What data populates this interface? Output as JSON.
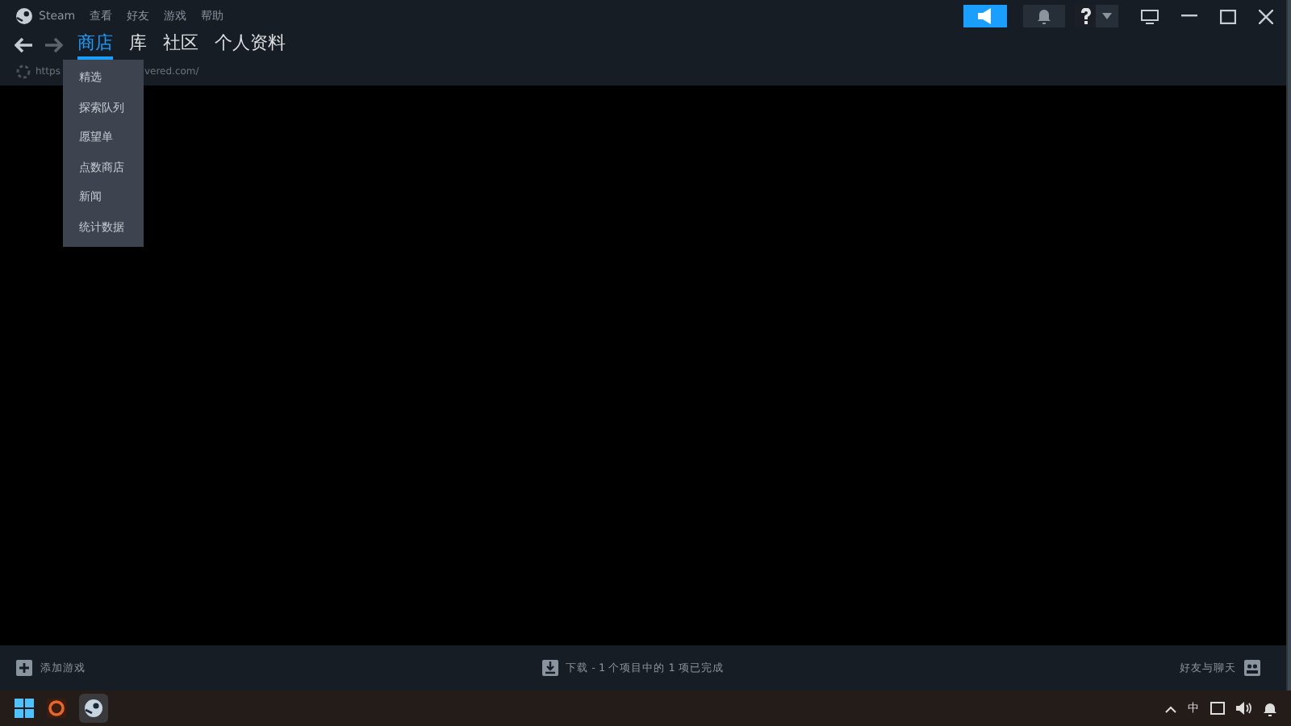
{
  "window": {
    "app_name": "Steam",
    "menu": [
      "查看",
      "好友",
      "游戏",
      "帮助"
    ]
  },
  "nav_tabs": [
    {
      "label": "商店",
      "selected": true
    },
    {
      "label": "库",
      "selected": false
    },
    {
      "label": "社区",
      "selected": false
    },
    {
      "label": "个人资料",
      "selected": false
    }
  ],
  "address": {
    "url_start": "https",
    "url_end": "vered.com/"
  },
  "dropdown": {
    "items": [
      "精选",
      "探索队列",
      "愿望单",
      "点数商店",
      "新闻",
      "统计数据"
    ]
  },
  "bottom_bar": {
    "add_game": "添加游戏",
    "downloads": "下载 - 1 个项目中的 1 项已完成",
    "friends": "好友与聊天"
  },
  "taskbar": {
    "tray_ime": "中"
  }
}
